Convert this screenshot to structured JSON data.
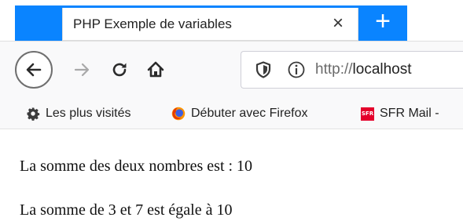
{
  "tab": {
    "title": "PHP Exemple de variables",
    "close_glyph": "×",
    "new_tab_glyph": "+"
  },
  "nav": {
    "back_icon": "back-arrow-icon",
    "forward_icon": "forward-arrow-icon",
    "reload_icon": "reload-icon",
    "home_icon": "home-icon"
  },
  "urlbar": {
    "shield_icon": "shield-icon",
    "info_icon": "info-icon",
    "url_protocol": "http://",
    "url_host": "localhost"
  },
  "bookmarks": [
    {
      "label": "Les plus visités",
      "icon": "gear-icon"
    },
    {
      "label": "Débuter avec Firefox",
      "icon": "firefox-icon"
    },
    {
      "label": "SFR Mail -",
      "icon": "sfr-icon",
      "icon_text": "SFR"
    }
  ],
  "content": {
    "line1": "La somme des deux nombres est : 10",
    "line2": "La somme de 3 et 7 est égale à 10"
  },
  "colors": {
    "accent_blue": "#0a84ff",
    "toolbar_bg": "#f9f9fa",
    "sfr_red": "#e4002b"
  }
}
